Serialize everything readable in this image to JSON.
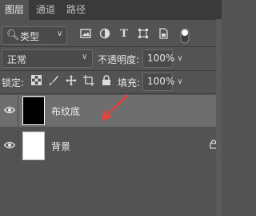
{
  "tabs": [
    {
      "label": "图层",
      "active": true
    },
    {
      "label": "通道",
      "active": false
    },
    {
      "label": "路径",
      "active": false
    }
  ],
  "filter": {
    "type_label": "类型",
    "icons": [
      "image-filter-icon",
      "adjustment-filter-icon",
      "type-filter-icon",
      "shape-filter-icon",
      "smart-object-filter-icon",
      "filter-toggle-icon"
    ]
  },
  "blend": {
    "mode": "正常",
    "opacity_label": "不透明度:",
    "opacity_value": "100%"
  },
  "lock": {
    "label": "锁定:",
    "fill_label": "填充:",
    "fill_value": "100%",
    "icons": [
      "lock-transparent-pixels-icon",
      "lock-image-pixels-icon",
      "lock-position-icon",
      "lock-artboard-icon",
      "lock-all-icon"
    ]
  },
  "layers": [
    {
      "name": "布纹底",
      "visible": true,
      "selected": true,
      "thumb_color": "#000000",
      "locked": false
    },
    {
      "name": "背景",
      "visible": true,
      "selected": false,
      "thumb_color": "#ffffff",
      "locked": true
    }
  ],
  "annotation": {
    "color": "#e8403a"
  }
}
